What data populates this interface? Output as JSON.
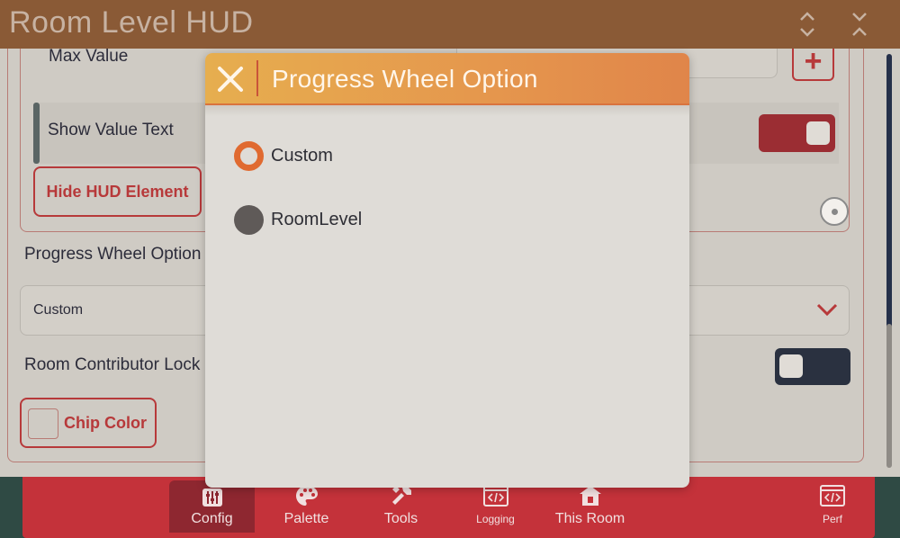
{
  "app": {
    "title": "Room Level HUD"
  },
  "settings": {
    "max_value_label": "Max Value",
    "show_value_text_label": "Show Value Text",
    "hide_button_label": "Hide HUD Element",
    "progress_wheel_label": "Progress Wheel Option",
    "progress_wheel_value": "Custom",
    "room_contributor_lock_label": "Room Contributor Lock",
    "chip_color_label": "Chip Color",
    "plus_label": "+"
  },
  "nav": {
    "items": [
      {
        "label": "Config",
        "icon": "sliders-icon"
      },
      {
        "label": "Palette",
        "icon": "palette-icon"
      },
      {
        "label": "Tools",
        "icon": "tools-icon"
      },
      {
        "label": "Logging",
        "icon": "code-icon"
      },
      {
        "label": "This Room",
        "icon": "house-icon"
      },
      {
        "label": "Perf",
        "icon": "code-icon"
      }
    ]
  },
  "modal": {
    "title": "Progress Wheel Option",
    "options": [
      {
        "label": "Custom",
        "selected": true
      },
      {
        "label": "RoomLevel",
        "selected": false
      }
    ]
  },
  "colors": {
    "accent_red": "#b7393a",
    "header_orange": "#e5964d",
    "radio_selected": "#e06a30",
    "nav_background": "#c4323a"
  }
}
